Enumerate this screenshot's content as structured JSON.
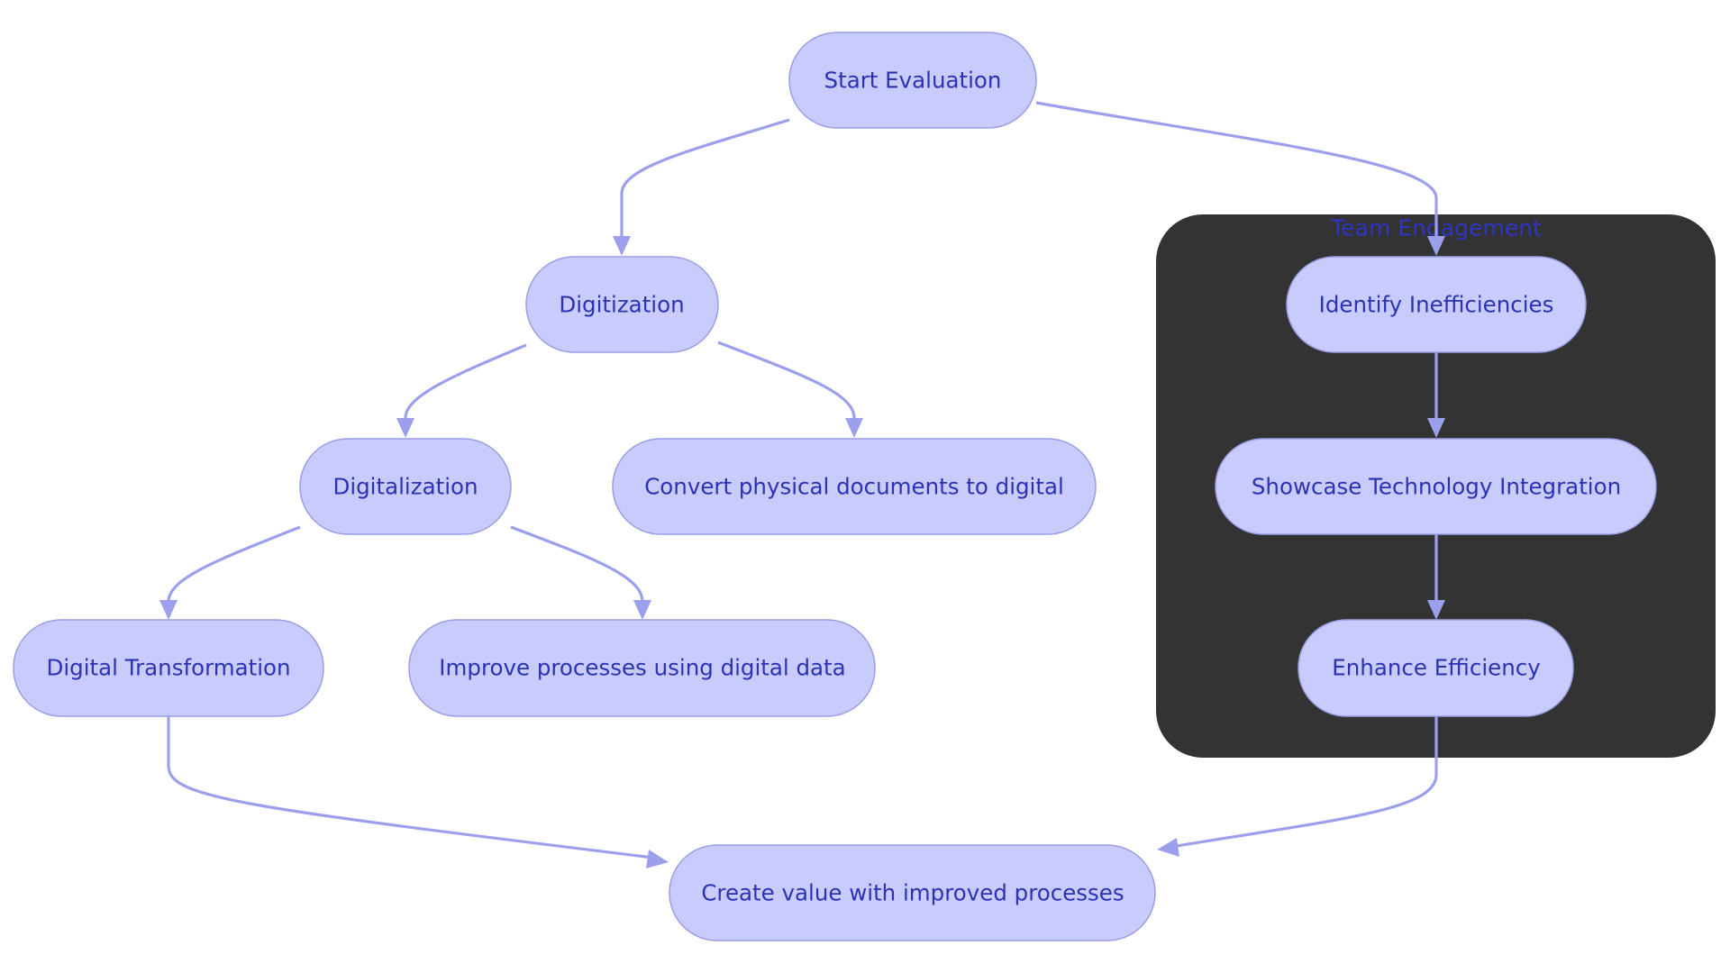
{
  "diagram": {
    "type": "flowchart",
    "colors": {
      "node_fill": "#c9cbfc",
      "node_stroke": "#9a9ee4",
      "node_text": "#2b33b4",
      "edge": "#9ca0ec",
      "cluster_fill": "#333333",
      "cluster_label": "#2f35c0"
    },
    "clusters": [
      {
        "id": "team",
        "label": "Team Engagement",
        "members": [
          "identify",
          "showcase",
          "enhance"
        ]
      }
    ],
    "nodes": [
      {
        "id": "start",
        "label": "Start Evaluation"
      },
      {
        "id": "digitization",
        "label": "Digitization"
      },
      {
        "id": "identify",
        "label": "Identify Inefficiencies"
      },
      {
        "id": "digitalization",
        "label": "Digitalization"
      },
      {
        "id": "convert",
        "label": "Convert physical documents to digital"
      },
      {
        "id": "showcase",
        "label": "Showcase Technology Integration"
      },
      {
        "id": "transformation",
        "label": "Digital Transformation"
      },
      {
        "id": "improve",
        "label": "Improve processes using digital data"
      },
      {
        "id": "enhance",
        "label": "Enhance Efficiency"
      },
      {
        "id": "create",
        "label": "Create value with improved processes"
      }
    ],
    "edges": [
      {
        "from": "start",
        "to": "digitization"
      },
      {
        "from": "start",
        "to": "identify"
      },
      {
        "from": "digitization",
        "to": "digitalization"
      },
      {
        "from": "digitization",
        "to": "convert"
      },
      {
        "from": "digitalization",
        "to": "transformation"
      },
      {
        "from": "digitalization",
        "to": "improve"
      },
      {
        "from": "identify",
        "to": "showcase"
      },
      {
        "from": "showcase",
        "to": "enhance"
      },
      {
        "from": "transformation",
        "to": "create"
      },
      {
        "from": "enhance",
        "to": "create"
      }
    ]
  }
}
